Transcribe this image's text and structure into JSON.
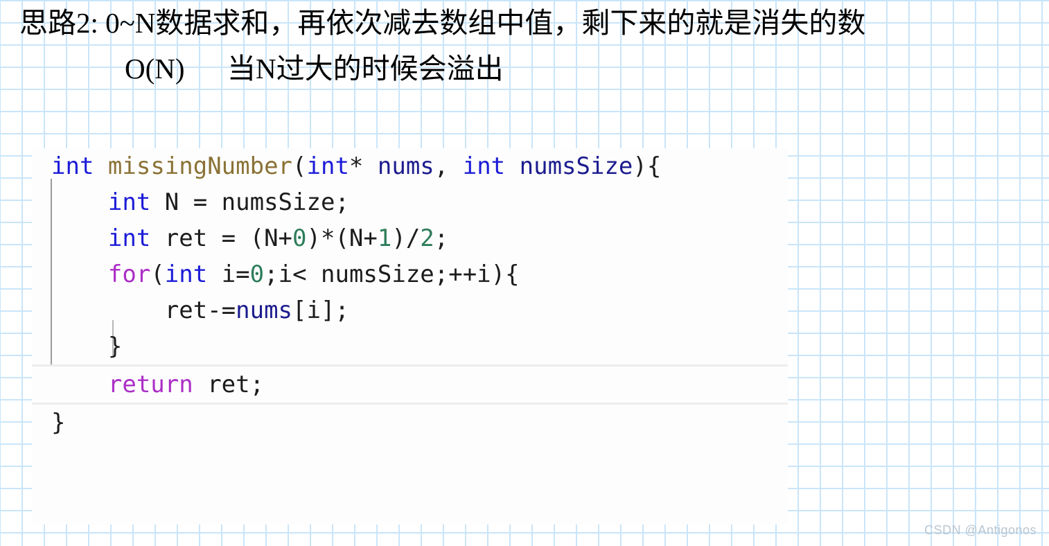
{
  "heading": {
    "line1": "思路2: 0~N数据求和，再依次减去数组中值，剩下来的就是消失的数",
    "line2": "O(N)      当N过大的时候会溢出"
  },
  "code": {
    "language": "c",
    "lines": [
      {
        "index": 1,
        "text": "int missingNumber(int* nums, int numsSize){",
        "tokens": [
          {
            "text": "int",
            "color": "#1b1bd8",
            "kind": "keyword"
          },
          {
            "text": " ",
            "color": "#1c1c1c",
            "kind": "space"
          },
          {
            "text": "missingNumber",
            "color": "#8a7236",
            "kind": "function"
          },
          {
            "text": "(",
            "color": "#1c1c1c",
            "kind": "punct"
          },
          {
            "text": "int",
            "color": "#1b1bd8",
            "kind": "keyword"
          },
          {
            "text": "* ",
            "color": "#1c1c1c",
            "kind": "punct"
          },
          {
            "text": "nums",
            "color": "#1c1c8f",
            "kind": "param"
          },
          {
            "text": ", ",
            "color": "#1c1c1c",
            "kind": "punct"
          },
          {
            "text": "int",
            "color": "#1b1bd8",
            "kind": "keyword"
          },
          {
            "text": " ",
            "color": "#1c1c1c",
            "kind": "space"
          },
          {
            "text": "numsSize",
            "color": "#1c1c8f",
            "kind": "param"
          },
          {
            "text": "){",
            "color": "#1c1c1c",
            "kind": "punct"
          }
        ]
      },
      {
        "index": 2,
        "text": "    int N = numsSize;",
        "tokens": [
          {
            "text": "    ",
            "color": "#1c1c1c",
            "kind": "space"
          },
          {
            "text": "int",
            "color": "#1b1bd8",
            "kind": "keyword"
          },
          {
            "text": " N = ",
            "color": "#1c1c1c",
            "kind": "plain"
          },
          {
            "text": "numsSize",
            "color": "#1c1c1c",
            "kind": "plain"
          },
          {
            "text": ";",
            "color": "#1c1c1c",
            "kind": "punct"
          }
        ]
      },
      {
        "index": 3,
        "text": "    int ret = (N+0)*(N+1)/2;",
        "tokens": [
          {
            "text": "    ",
            "color": "#1c1c1c",
            "kind": "space"
          },
          {
            "text": "int",
            "color": "#1b1bd8",
            "kind": "keyword"
          },
          {
            "text": " ret = (N+",
            "color": "#1c1c1c",
            "kind": "plain"
          },
          {
            "text": "0",
            "color": "#2e7d5b",
            "kind": "number"
          },
          {
            "text": ")*(N+",
            "color": "#1c1c1c",
            "kind": "punct"
          },
          {
            "text": "1",
            "color": "#2e7d5b",
            "kind": "number"
          },
          {
            "text": ")/",
            "color": "#1c1c1c",
            "kind": "punct"
          },
          {
            "text": "2",
            "color": "#2e7d5b",
            "kind": "number"
          },
          {
            "text": ";",
            "color": "#1c1c1c",
            "kind": "punct"
          }
        ]
      },
      {
        "index": 4,
        "text": "    for(int i=0;i< numsSize;++i){",
        "tokens": [
          {
            "text": "    ",
            "color": "#1c1c1c",
            "kind": "space"
          },
          {
            "text": "for",
            "color": "#ab2ec6",
            "kind": "control"
          },
          {
            "text": "(",
            "color": "#1c1c1c",
            "kind": "punct"
          },
          {
            "text": "int",
            "color": "#1b1bd8",
            "kind": "keyword"
          },
          {
            "text": " i=",
            "color": "#1c1c1c",
            "kind": "plain"
          },
          {
            "text": "0",
            "color": "#2e7d5b",
            "kind": "number"
          },
          {
            "text": ";i< numsSize;++i){",
            "color": "#1c1c1c",
            "kind": "plain"
          }
        ]
      },
      {
        "index": 5,
        "text": "        ret-=nums[i];",
        "tokens": [
          {
            "text": "        ",
            "color": "#1c1c1c",
            "kind": "space"
          },
          {
            "text": "ret-=",
            "color": "#1c1c1c",
            "kind": "plain"
          },
          {
            "text": "nums",
            "color": "#1c1c8f",
            "kind": "param"
          },
          {
            "text": "[i];",
            "color": "#1c1c1c",
            "kind": "punct"
          }
        ]
      },
      {
        "index": 6,
        "text": "    }",
        "tokens": [
          {
            "text": "    }",
            "color": "#1c1c1c",
            "kind": "punct"
          }
        ]
      },
      {
        "index": 7,
        "text": "    return ret;",
        "current": true,
        "tokens": [
          {
            "text": "    ",
            "color": "#1c1c1c",
            "kind": "space"
          },
          {
            "text": "return",
            "color": "#ab2ec6",
            "kind": "control"
          },
          {
            "text": " ret;",
            "color": "#1c1c1c",
            "kind": "plain"
          }
        ]
      },
      {
        "index": 8,
        "text": "}",
        "tokens": [
          {
            "text": "}",
            "color": "#1c1c1c",
            "kind": "punct"
          }
        ]
      }
    ]
  },
  "watermark": "CSDN @Antigonos",
  "colors": {
    "grid_line": "#c9e5f9",
    "page_background": "#ffffff",
    "card_background": "#fdfdfd",
    "keyword": "#1b1bd8",
    "control_keyword": "#ab2ec6",
    "function_name": "#8a7236",
    "parameter": "#1c1c8f",
    "number_literal": "#2e7d5b",
    "plain_text": "#1c1c1c",
    "current_line_border": "#ededed",
    "indent_guide": "#9a9a9a",
    "watermark": "#b9c6d2"
  }
}
